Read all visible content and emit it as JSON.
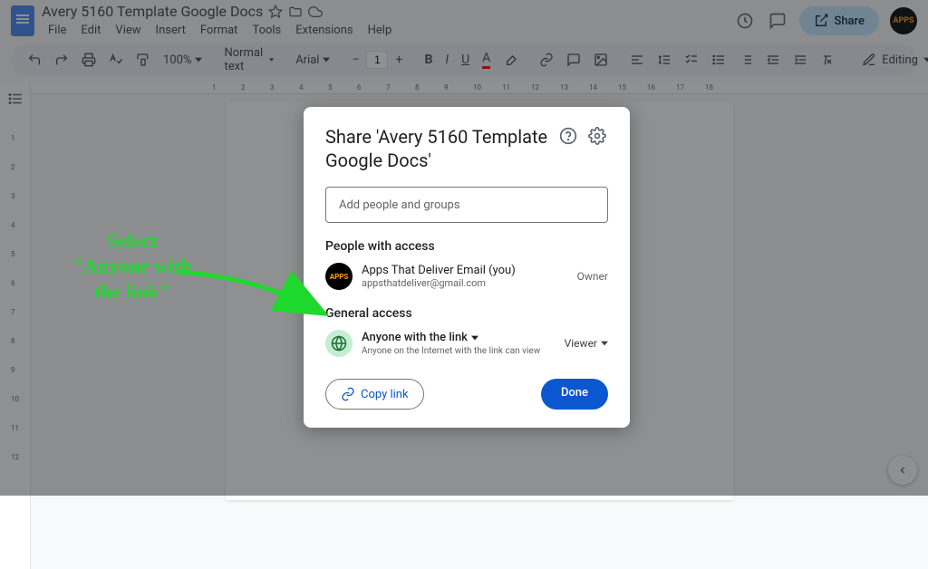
{
  "header": {
    "title": "Avery 5160 Template Google Docs",
    "menus": [
      "File",
      "Edit",
      "View",
      "Insert",
      "Format",
      "Tools",
      "Extensions",
      "Help"
    ],
    "share": "Share",
    "avatar": "APPS"
  },
  "toolbar": {
    "zoom": "100%",
    "style": "Normal text",
    "font": "Arial",
    "size": "1",
    "editing": "Editing"
  },
  "modal": {
    "title": "Share 'Avery 5160 Template Google Docs'",
    "placeholder": "Add people and groups",
    "people_label": "People with access",
    "owner_name": "Apps That Deliver Email (you)",
    "owner_email": "appsthatdeliver@gmail.com",
    "owner_role": "Owner",
    "general_label": "General access",
    "access_level": "Anyone with the link",
    "access_desc": "Anyone on the Internet with the link can view",
    "viewer": "Viewer",
    "copy_link": "Copy link",
    "done": "Done"
  },
  "annotation": {
    "line1": "Select",
    "line2": "\"Anyone with",
    "line3": "the link\""
  },
  "ruler_ticks_top": [
    "1",
    "2",
    "3",
    "4",
    "5",
    "6",
    "7",
    "8",
    "9",
    "10",
    "11",
    "12",
    "13",
    "14",
    "15",
    "16",
    "17",
    "18"
  ],
  "ruler_ticks_left": [
    "1",
    "2",
    "3",
    "4",
    "5",
    "6",
    "7",
    "8",
    "9",
    "10",
    "11",
    "12"
  ]
}
